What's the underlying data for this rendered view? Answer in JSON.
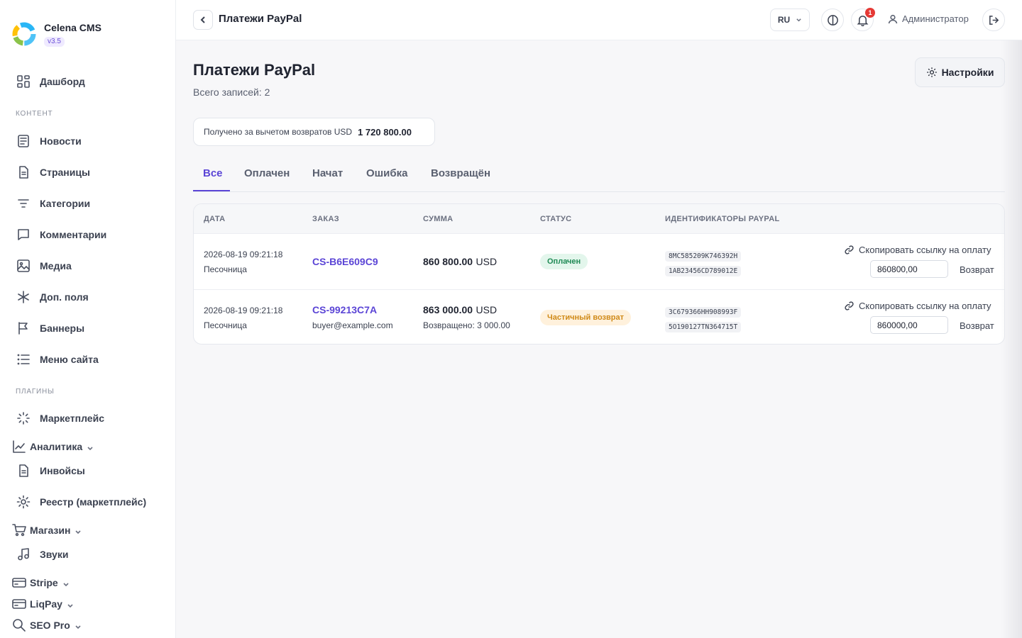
{
  "brand": {
    "name": "Celena CMS",
    "version": "v3.5"
  },
  "sidebar": {
    "dashboard": "Дашборд",
    "section_content": "КОНТЕНТ",
    "content_items": [
      "Новости",
      "Страницы",
      "Категории",
      "Комментарии",
      "Медиа",
      "Доп. поля",
      "Баннеры",
      "Меню сайта"
    ],
    "section_plugins": "ПЛАГИНЫ",
    "plugin_items": [
      "Маркетплейс",
      "Аналитика",
      "Инвойсы",
      "Реестр (маркетплейс)",
      "Магазин",
      "Звуки",
      "Stripe",
      "LiqPay",
      "SEO Pro"
    ]
  },
  "topbar": {
    "title": "Платежи PayPal",
    "lang": "RU",
    "notifications_count": "1",
    "user": "Администратор"
  },
  "page": {
    "title": "Платежи PayPal",
    "subtitle": "Всего записей: 2",
    "settings_label": "Настройки",
    "summary_label": "Получено за вычетом возвратов USD",
    "summary_value": "1 720 800.00"
  },
  "tabs": [
    "Все",
    "Оплачен",
    "Начат",
    "Ошибка",
    "Возвращён"
  ],
  "table": {
    "headers": [
      "ДАТА",
      "ЗАКАЗ",
      "СУММА",
      "СТАТУС",
      "ИДЕНТИФИКАТОРЫ PAYPAL"
    ],
    "copy_label": "Скопировать ссылку на оплату",
    "refund_label": "Возврат",
    "rows": [
      {
        "date": "2026-08-19 09:21:18",
        "env": "Песочница",
        "order": "CS-B6E609C9",
        "buyer": "",
        "amount": "860 800.00",
        "currency": "USD",
        "refunded": "",
        "status": "Оплачен",
        "id1": "8MC585209K746392H",
        "id2": "1AB23456CD789012E",
        "refund_value": "860800,00"
      },
      {
        "date": "2026-08-19 09:21:18",
        "env": "Песочница",
        "order": "CS-99213C7A",
        "buyer": "buyer@example.com",
        "amount": "863 000.00",
        "currency": "USD",
        "refunded": "Возвращено: 3 000.00",
        "status": "Частичный возврат",
        "id1": "3C679366HH908993F",
        "id2": "5O190127TN364715T",
        "refund_value": "860000,00"
      }
    ]
  },
  "colors": {
    "accent": "#5b45d6",
    "paid": "#1f8a55",
    "partial": "#d08a18",
    "badge": "#e53935"
  }
}
